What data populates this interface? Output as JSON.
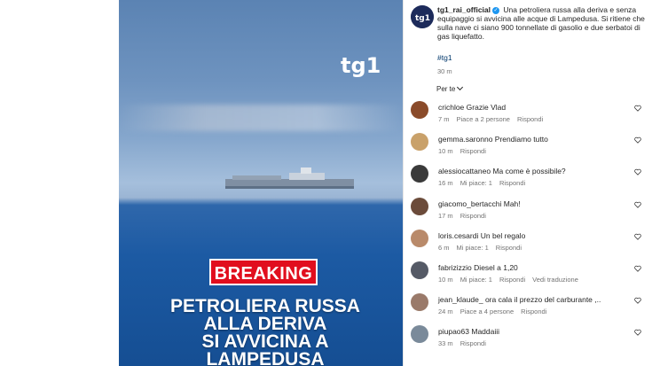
{
  "post": {
    "overlay": {
      "breaking": "BREAKING",
      "headline": "PETROLIERA RUSSA\nALLA DERIVA\nSI AVVICINA A\nLAMPEDUSA",
      "logo_text": "tg1"
    },
    "caption": {
      "username": "tg1_rai_official",
      "text": "Una petroliera russa alla deriva e senza equipaggio si avvicina alle acque di Lampedusa. Si ritiene che sulla nave ci siano 900 tonnellate di gasolio e due serbatoi di gas liquefatto.",
      "hashtag": "#tg1",
      "time": "30 m"
    },
    "sort_label": "Per te",
    "comments": [
      {
        "user": "crichloe",
        "text": "Grazie Vlad",
        "time": "7 m",
        "likes": "Piace a 2 persone",
        "reply": "Rispondi",
        "translate": ""
      },
      {
        "user": "gemma.saronno",
        "text": "Prendiamo tutto",
        "time": "10 m",
        "likes": "",
        "reply": "Rispondi",
        "translate": ""
      },
      {
        "user": "alessiocattaneo",
        "text": "Ma come è possibile?",
        "time": "16 m",
        "likes": "Mi piace: 1",
        "reply": "Rispondi",
        "translate": ""
      },
      {
        "user": "giacomo_bertacchi",
        "text": "Mah!",
        "time": "17 m",
        "likes": "",
        "reply": "Rispondi",
        "translate": ""
      },
      {
        "user": "loris.cesardi",
        "text": "Un bel regalo",
        "time": "6 m",
        "likes": "Mi piace: 1",
        "reply": "Rispondi",
        "translate": ""
      },
      {
        "user": "fabrizizzio",
        "text": "Diesel a 1,20",
        "time": "10 m",
        "likes": "Mi piace: 1",
        "reply": "Rispondi",
        "translate": "Vedi traduzione"
      },
      {
        "user": "jean_klaude_",
        "text": "ora cala il prezzo del carburante ,..",
        "time": "24 m",
        "likes": "Piace a 4 persone",
        "reply": "Rispondi",
        "translate": ""
      },
      {
        "user": "piupao63",
        "text": "Maddaiii",
        "time": "33 m",
        "likes": "",
        "reply": "Rispondi",
        "translate": ""
      }
    ],
    "colors": {
      "breaking_bg": "#e10e1e",
      "link": "#00376b",
      "verified": "#1c96f0",
      "meta": "#737373"
    }
  }
}
